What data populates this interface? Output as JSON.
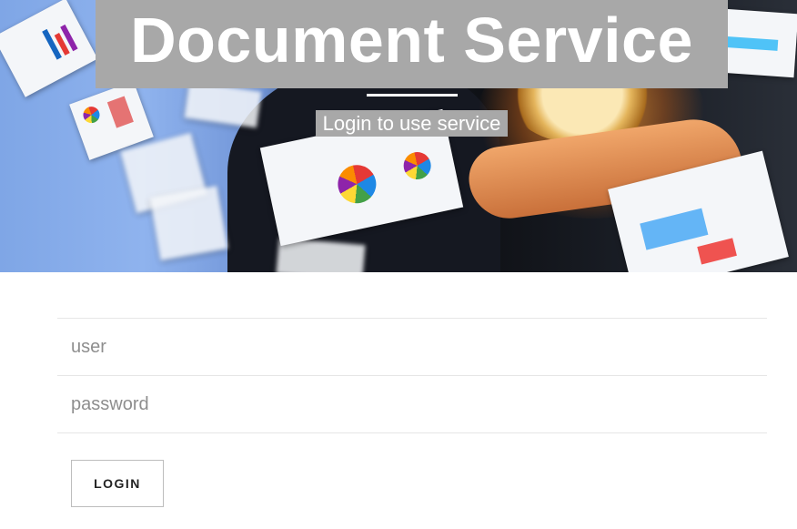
{
  "hero": {
    "title": "Document Service",
    "subtitle": "Login to use service"
  },
  "login_form": {
    "user_placeholder": "user",
    "password_placeholder": "password",
    "login_label": "LOGIN"
  }
}
